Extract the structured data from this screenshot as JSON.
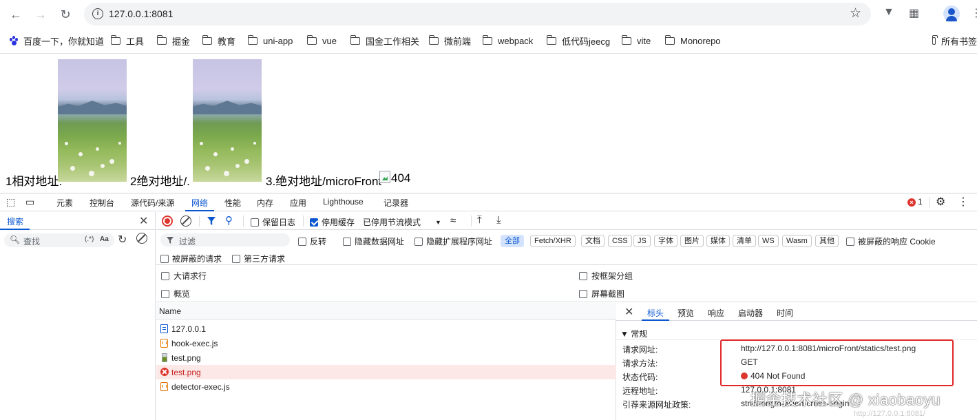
{
  "browser": {
    "url": "127.0.0.1:8081",
    "bookmarks": [
      {
        "label": "百度一下，你就知道",
        "icon": "baidu-paw-icon"
      },
      {
        "label": "工具",
        "icon": "folder-icon"
      },
      {
        "label": "掘金",
        "icon": "folder-icon"
      },
      {
        "label": "教育",
        "icon": "folder-icon"
      },
      {
        "label": "uni-app",
        "icon": "folder-icon"
      },
      {
        "label": "vue",
        "icon": "folder-icon"
      },
      {
        "label": "国金工作相关",
        "icon": "folder-icon"
      },
      {
        "label": "微前端",
        "icon": "folder-icon"
      },
      {
        "label": "webpack",
        "icon": "folder-icon"
      },
      {
        "label": "低代码jeecg",
        "icon": "folder-icon"
      },
      {
        "label": "vite",
        "icon": "folder-icon"
      },
      {
        "label": "Monorepo",
        "icon": "folder-icon"
      },
      {
        "label": "所有书签",
        "icon": "folder-icon"
      }
    ]
  },
  "page": {
    "text1": "1相对地址.",
    "text2": "2绝对地址/.",
    "text3": "3.绝对地址/microFront",
    "broken_alt": "404"
  },
  "devtools": {
    "tabs": [
      "元素",
      "控制台",
      "源代码/来源",
      "网络",
      "性能",
      "内存",
      "应用",
      "Lighthouse",
      "记录器"
    ],
    "active_tab": "网络",
    "error_count": "1",
    "search": {
      "title": "搜索",
      "placeholder": "查找",
      "regex": "(.*)",
      "case": "Aa"
    },
    "network": {
      "preserve_log": "保留日志",
      "disable_cache": "停用缓存",
      "throttle": "已停用节流模式",
      "filter_placeholder": "过滤",
      "invert": "反转",
      "hide_data_urls": "隐藏数据网址",
      "hide_ext_urls": "隐藏扩展程序网址",
      "type_chips": [
        "全部",
        "Fetch/XHR",
        "文档",
        "CSS",
        "JS",
        "字体",
        "图片",
        "媒体",
        "清单",
        "WS",
        "Wasm",
        "其他"
      ],
      "blocked_cookies": "被屏蔽的响应 Cookie",
      "blocked_requests": "被屏蔽的请求",
      "third_party": "第三方请求",
      "big_rows": "大请求行",
      "group_by_frame": "按框架分组",
      "overview": "概览",
      "screenshots": "屏幕截图",
      "list_header": "Name",
      "requests": [
        {
          "name": "127.0.0.1",
          "type": "doc",
          "error": false
        },
        {
          "name": "hook-exec.js",
          "type": "js",
          "error": false
        },
        {
          "name": "test.png",
          "type": "img",
          "error": false
        },
        {
          "name": "test.png",
          "type": "err",
          "error": true
        },
        {
          "name": "detector-exec.js",
          "type": "js",
          "error": false
        }
      ],
      "detail_tabs": [
        "标头",
        "预览",
        "响应",
        "启动器",
        "时间"
      ],
      "general_title": "▼ 常规",
      "general": [
        {
          "key": "请求网址:",
          "value": "http://127.0.0.1:8081/microFront/statics/test.png"
        },
        {
          "key": "请求方法:",
          "value": "GET"
        },
        {
          "key": "状态代码:",
          "value": "404 Not Found"
        },
        {
          "key": "远程地址:",
          "value": "127.0.0.1:8081"
        },
        {
          "key": "引荐来源网址政策:",
          "value": "strict-origin-when-cross-origin"
        }
      ]
    }
  },
  "watermark": {
    "main": "掘金技术社区 @ xiaobaoyu",
    "sub": "http://127.0.0.1:8081/"
  }
}
